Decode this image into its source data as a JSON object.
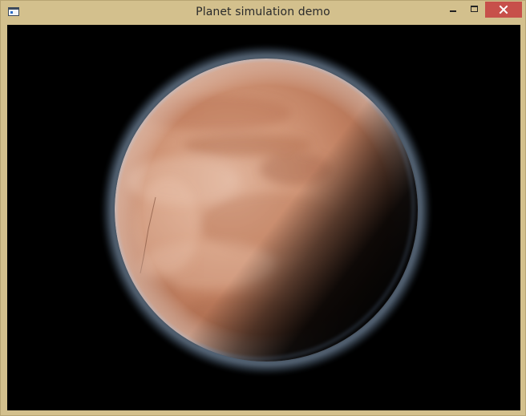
{
  "window": {
    "title": "Planet simulation demo",
    "frame_color": "#d3c08d",
    "close_button_color": "#c7504a"
  },
  "icons": {
    "app": "application-window-icon",
    "minimize": "minimize-icon",
    "maximize": "maximize-icon",
    "close": "close-icon"
  },
  "scene": {
    "background_color": "#000000",
    "planet_base_color": "#c98866",
    "atmosphere_color": "#8fb3d8"
  }
}
